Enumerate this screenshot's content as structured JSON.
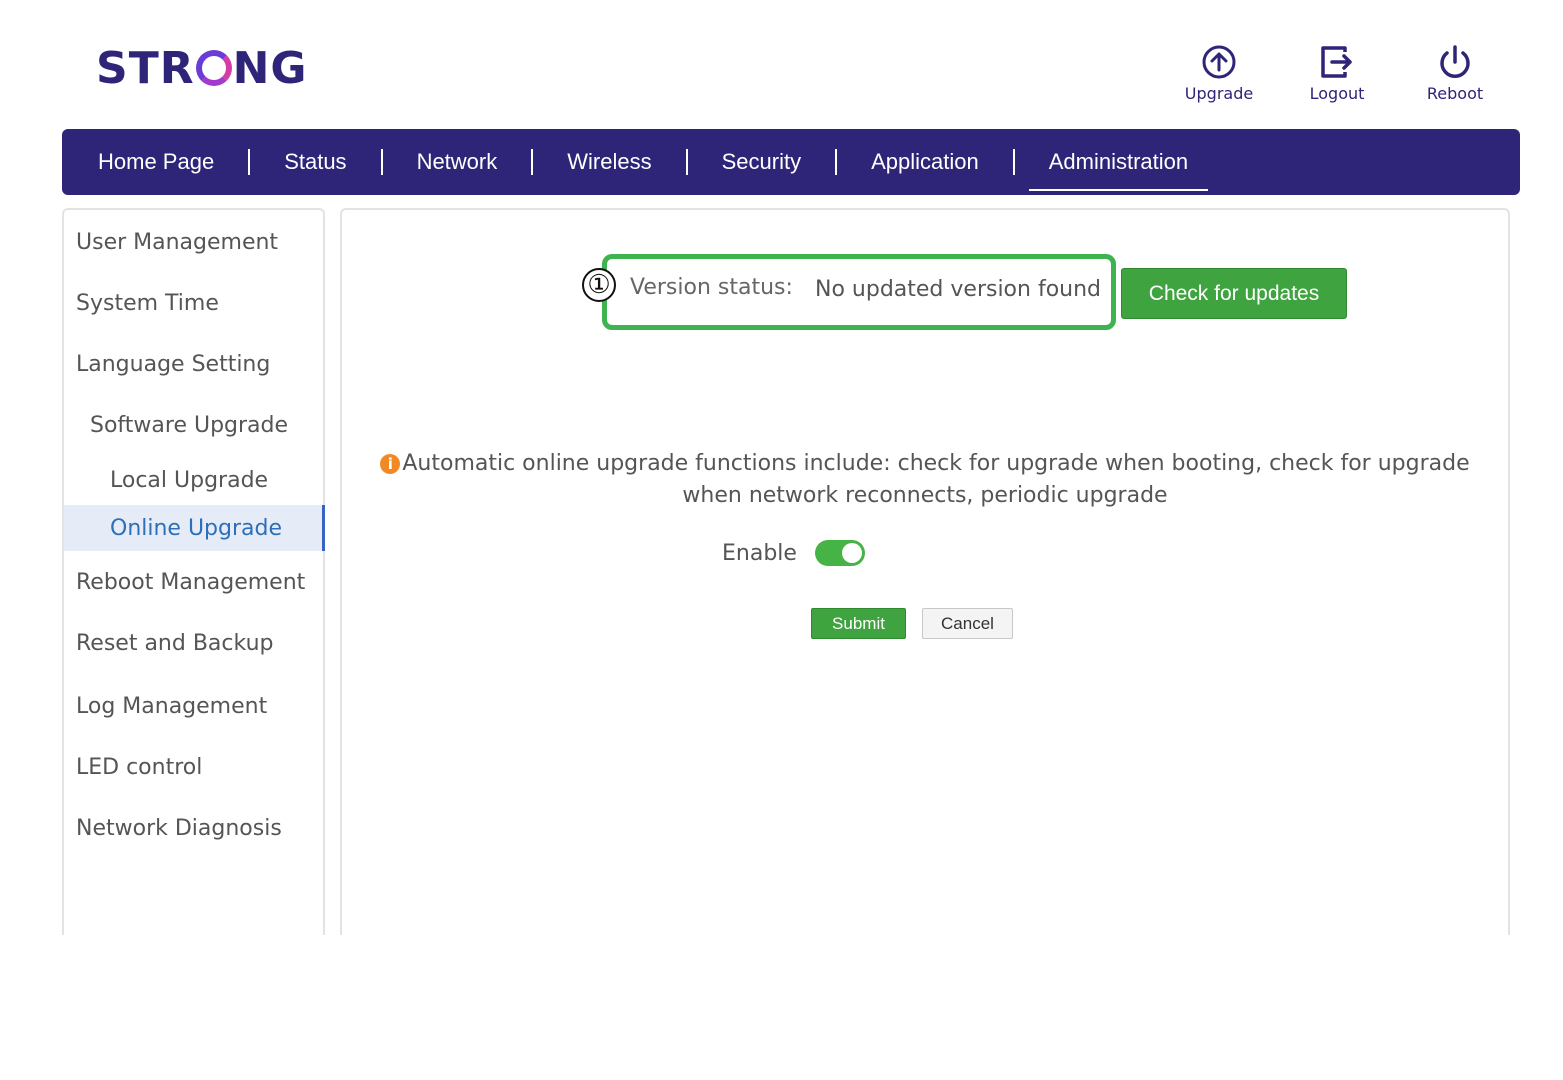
{
  "brand": {
    "logo_text_1": "STR",
    "logo_text_2": "NG"
  },
  "top_actions": [
    {
      "label": "Upgrade",
      "icon": "upgrade-icon"
    },
    {
      "label": "Logout",
      "icon": "logout-icon"
    },
    {
      "label": "Reboot",
      "icon": "power-icon"
    }
  ],
  "nav": {
    "items": [
      "Home Page",
      "Status",
      "Network",
      "Wireless",
      "Security",
      "Application",
      "Administration"
    ],
    "active": "Administration"
  },
  "sidebar": {
    "items": [
      "User Management",
      "System Time",
      "Language Setting",
      "Software Upgrade",
      "Local Upgrade",
      "Online Upgrade",
      "Reboot Management",
      "Reset and Backup",
      "Log Management",
      "LED control",
      "Network Diagnosis"
    ],
    "active": "Online Upgrade"
  },
  "main": {
    "callout_number": "①",
    "version_status_label": "Version status:",
    "version_status_value": "No updated version found",
    "check_button": "Check for updates",
    "info_text_line1": "Automatic online upgrade functions include: check for upgrade when booting, check for upgrade",
    "info_text_line2": "when network reconnects, periodic upgrade",
    "enable_label": "Enable",
    "enable_state": true,
    "submit_button": "Submit",
    "cancel_button": "Cancel"
  },
  "colors": {
    "brand_navy": "#2e2478",
    "accent_green": "#3fa33f",
    "highlight_green": "#3fb34f",
    "info_orange": "#f08a24",
    "active_link_blue": "#2d6fb8"
  }
}
